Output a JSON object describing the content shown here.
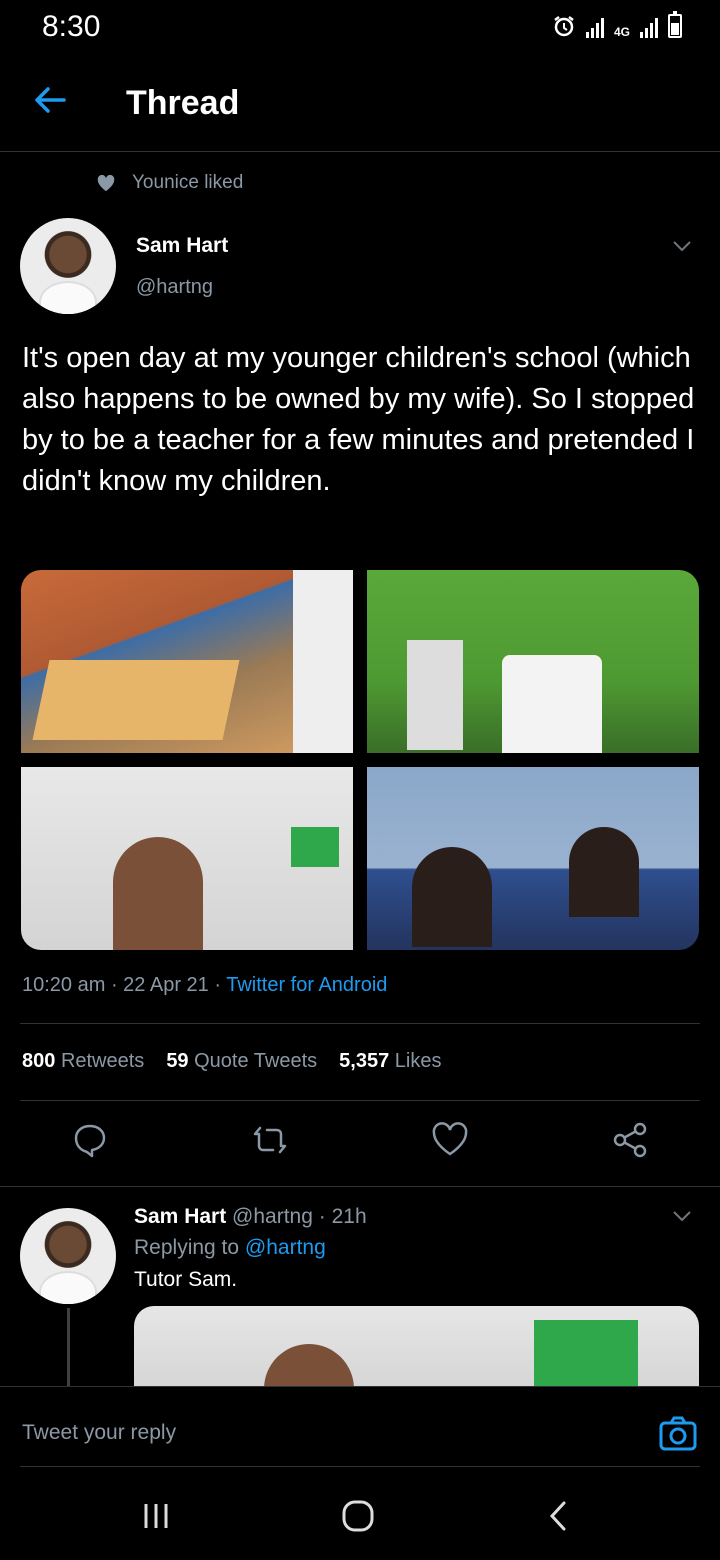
{
  "status": {
    "time": "8:30",
    "network": "4G"
  },
  "header": {
    "title": "Thread"
  },
  "social_context": {
    "text": "Younice liked"
  },
  "tweet": {
    "author_name": "Sam Hart",
    "author_handle": "@hartng",
    "text": "It's open day at my younger children's school (which also happens to be owned by my wife). So I stopped by to be a teacher for a few minutes and pretended I didn't know my children.",
    "time": "10:20 am",
    "date": "22 Apr 21",
    "source": "Twitter for Android",
    "stats": {
      "retweets_count": "800",
      "retweets_label": "Retweets",
      "quotes_count": "59",
      "quotes_label": "Quote Tweets",
      "likes_count": "5,357",
      "likes_label": "Likes"
    }
  },
  "reply": {
    "author_name": "Sam Hart",
    "author_handle": "@hartng",
    "age": "21h",
    "replying_label": "Replying to",
    "replying_to": "@hartng",
    "text": "Tutor Sam."
  },
  "composer": {
    "placeholder": "Tweet your reply"
  },
  "colors": {
    "background": "#000000",
    "accent": "#1d9bf0",
    "muted": "#8b98a5",
    "divider": "#2f3336"
  },
  "icons": [
    "back-arrow-icon",
    "heart-icon",
    "chevron-down-icon",
    "reply-icon",
    "retweet-icon",
    "like-icon",
    "share-icon",
    "camera-icon",
    "recent-apps-icon",
    "home-icon",
    "back-icon"
  ]
}
